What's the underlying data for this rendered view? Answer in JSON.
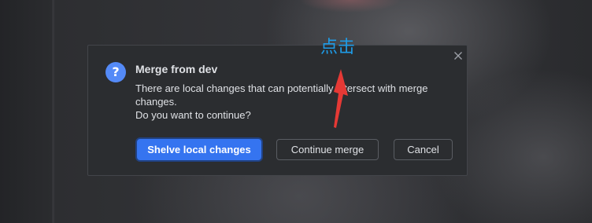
{
  "dialog": {
    "title": "Merge from dev",
    "message_lines": [
      "There are local changes that can potentially intersect with merge",
      "changes.",
      "Do you want to continue?"
    ],
    "icon": "question-icon",
    "icon_glyph": "?",
    "close_icon": "close-icon",
    "buttons": {
      "primary": "Shelve local changes",
      "continue": "Continue merge",
      "cancel": "Cancel"
    }
  },
  "annotation": {
    "text": "点击",
    "color": "#1e9ce8",
    "arrow_color": "#e53935"
  },
  "colors": {
    "accent": "#3574f0",
    "dialog_bg": "#2b2d30",
    "text": "#dfe1e5"
  }
}
